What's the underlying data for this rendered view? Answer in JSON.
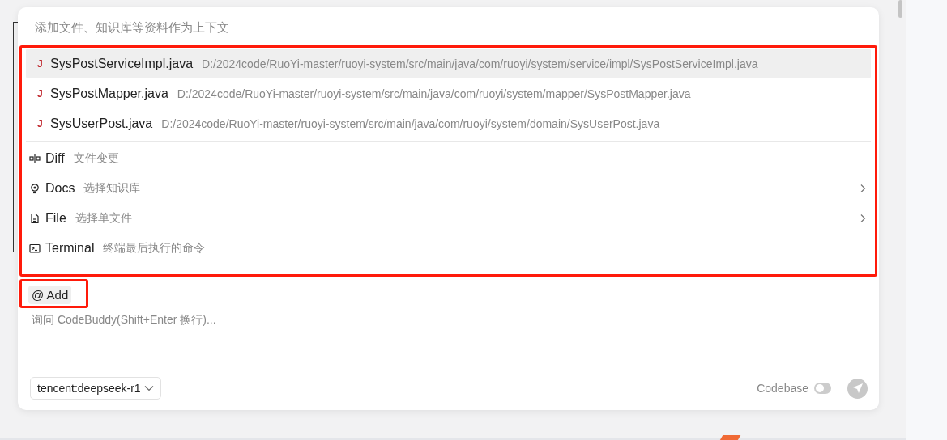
{
  "context_hint": "添加文件、知识库等资料作为上下文",
  "files": [
    {
      "icon": "J",
      "name": "SysPostServiceImpl.java",
      "path": "D:/2024code/RuoYi-master/ruoyi-system/src/main/java/com/ruoyi/system/service/impl/SysPostServiceImpl.java",
      "selected": true
    },
    {
      "icon": "J",
      "name": "SysPostMapper.java",
      "path": "D:/2024code/RuoYi-master/ruoyi-system/src/main/java/com/ruoyi/system/mapper/SysPostMapper.java",
      "selected": false
    },
    {
      "icon": "J",
      "name": "SysUserPost.java",
      "path": "D:/2024code/RuoYi-master/ruoyi-system/src/main/java/com/ruoyi/system/domain/SysUserPost.java",
      "selected": false
    }
  ],
  "commands": [
    {
      "kind": "diff",
      "label": "Diff",
      "description": "文件变更",
      "has_submenu": false
    },
    {
      "kind": "docs",
      "label": "Docs",
      "description": "选择知识库",
      "has_submenu": true
    },
    {
      "kind": "file",
      "label": "File",
      "description": "选择单文件",
      "has_submenu": true
    },
    {
      "kind": "terminal",
      "label": "Terminal",
      "description": "终端最后执行的命令",
      "has_submenu": false
    }
  ],
  "add_button": "@ Add",
  "input": {
    "placeholder": "询问 CodeBuddy(Shift+Enter 换行)..."
  },
  "model_select": {
    "value": "tencent:deepseek-r1"
  },
  "codebase_toggle": {
    "label": "Codebase",
    "on": false
  }
}
